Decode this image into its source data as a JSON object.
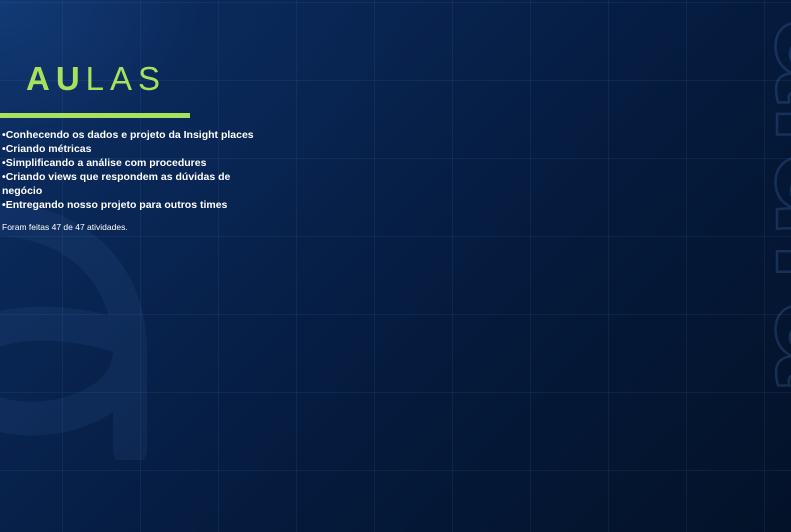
{
  "slide": {
    "title_bold": "AU",
    "title_light": "LAS",
    "lessons": [
      "Conhecendo os dados e projeto da Insight places",
      "Criando métricas",
      "Simplificando a análise com procedures",
      "Criando views que respondem as dúvidas de negócio",
      "Entregando nosso projeto para outros times"
    ],
    "summary": "Foram feitas 47 de 47 atividades.",
    "watermark_text": "alura"
  },
  "colors": {
    "accent": "#a8e05f",
    "background": "#04152e",
    "text": "#ffffff"
  }
}
